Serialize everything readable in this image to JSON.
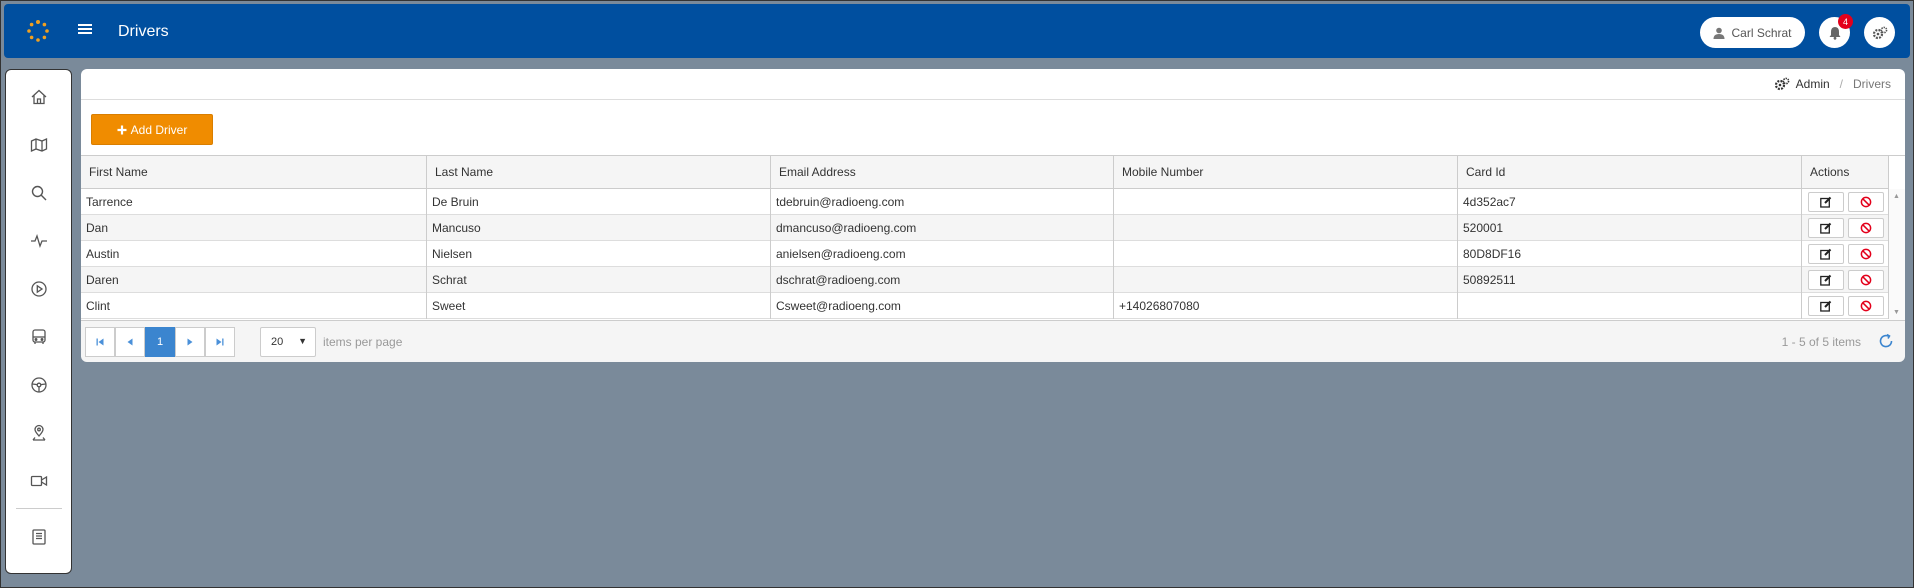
{
  "header": {
    "title": "Drivers",
    "user_name": "Carl Schrat",
    "notification_count": "4"
  },
  "breadcrumb": {
    "admin": "Admin",
    "separator": "/",
    "current": "Drivers"
  },
  "toolbar": {
    "add_label": "Add Driver"
  },
  "grid": {
    "columns": [
      "First Name",
      "Last Name",
      "Email Address",
      "Mobile Number",
      "Card Id",
      "Actions"
    ],
    "rows": [
      {
        "first": "Tarrence",
        "last": "De Bruin",
        "email": "tdebruin@radioeng.com",
        "mobile": "",
        "card": "4d352ac7"
      },
      {
        "first": "Dan",
        "last": "Mancuso",
        "email": "dmancuso@radioeng.com",
        "mobile": "",
        "card": "520001"
      },
      {
        "first": "Austin",
        "last": "Nielsen",
        "email": "anielsen@radioeng.com",
        "mobile": "",
        "card": "80D8DF16"
      },
      {
        "first": "Daren",
        "last": "Schrat",
        "email": "dschrat@radioeng.com",
        "mobile": "",
        "card": "50892511"
      },
      {
        "first": "Clint",
        "last": "Sweet",
        "email": "Csweet@radioeng.com",
        "mobile": "+14026807080",
        "card": ""
      }
    ]
  },
  "pager": {
    "current_page": "1",
    "page_size": "20",
    "items_per_page_label": "items per page",
    "info": "1 - 5 of 5 items"
  },
  "icons": {
    "sidebar": [
      "home-icon",
      "map-icon",
      "search-icon",
      "activity-icon",
      "play-icon",
      "bus-icon",
      "steering-wheel-icon",
      "location-pin-icon",
      "video-camera-icon",
      "book-icon"
    ]
  },
  "colors": {
    "header": "#004f9f",
    "accent": "#f08c00",
    "active_page": "#3b85cf",
    "badge": "#e3001b",
    "delete": "#e3001b"
  }
}
